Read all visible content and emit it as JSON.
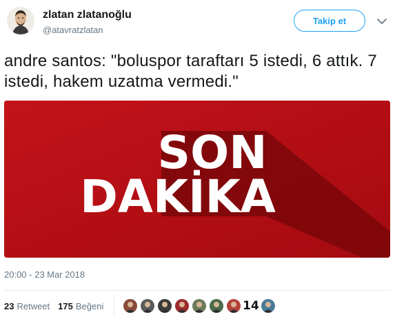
{
  "author": {
    "name": "zlatan zlatanoğlu",
    "handle": "@atavratzlatan",
    "avatar_icon": "person-avatar-icon"
  },
  "actions": {
    "follow_label": "Takip et",
    "more_icon": "chevron-down-icon"
  },
  "tweet": {
    "text": "andre santos: \"boluspor taraftarı 5 istedi, 6 attık. 7 istedi, hakem uzatma vermedi.\"",
    "media": {
      "line1": "SON",
      "line2": "DAKİKA",
      "bg_color": "#b10d12",
      "shadow_color": "#7a0709",
      "text_color": "#ffffff"
    },
    "timestamp": "20:00 - 23 Mar 2018"
  },
  "stats": {
    "retweets_count": "23",
    "retweets_label": "Retweet",
    "likes_count": "175",
    "likes_label": "Beğeni"
  },
  "likers": [
    {
      "name": "liker-avatar-1",
      "color": "#8a4a3a"
    },
    {
      "name": "liker-avatar-2",
      "color": "#5b5b5b"
    },
    {
      "name": "liker-avatar-3",
      "color": "#3a3a3a"
    },
    {
      "name": "liker-avatar-4",
      "color": "#9c2b2b"
    },
    {
      "name": "liker-avatar-5",
      "color": "#6d7a5a"
    },
    {
      "name": "liker-avatar-6",
      "color": "#4a6a4a"
    },
    {
      "name": "liker-avatar-7",
      "color": "#b3423a"
    },
    {
      "name": "liker-avatar-8",
      "text": "14",
      "color": "#ffffff"
    },
    {
      "name": "liker-avatar-9",
      "color": "#4a7a9a"
    }
  ],
  "colors": {
    "accent": "#1da1f2",
    "secondary_text": "#657786",
    "divider": "#e6ecf0"
  }
}
